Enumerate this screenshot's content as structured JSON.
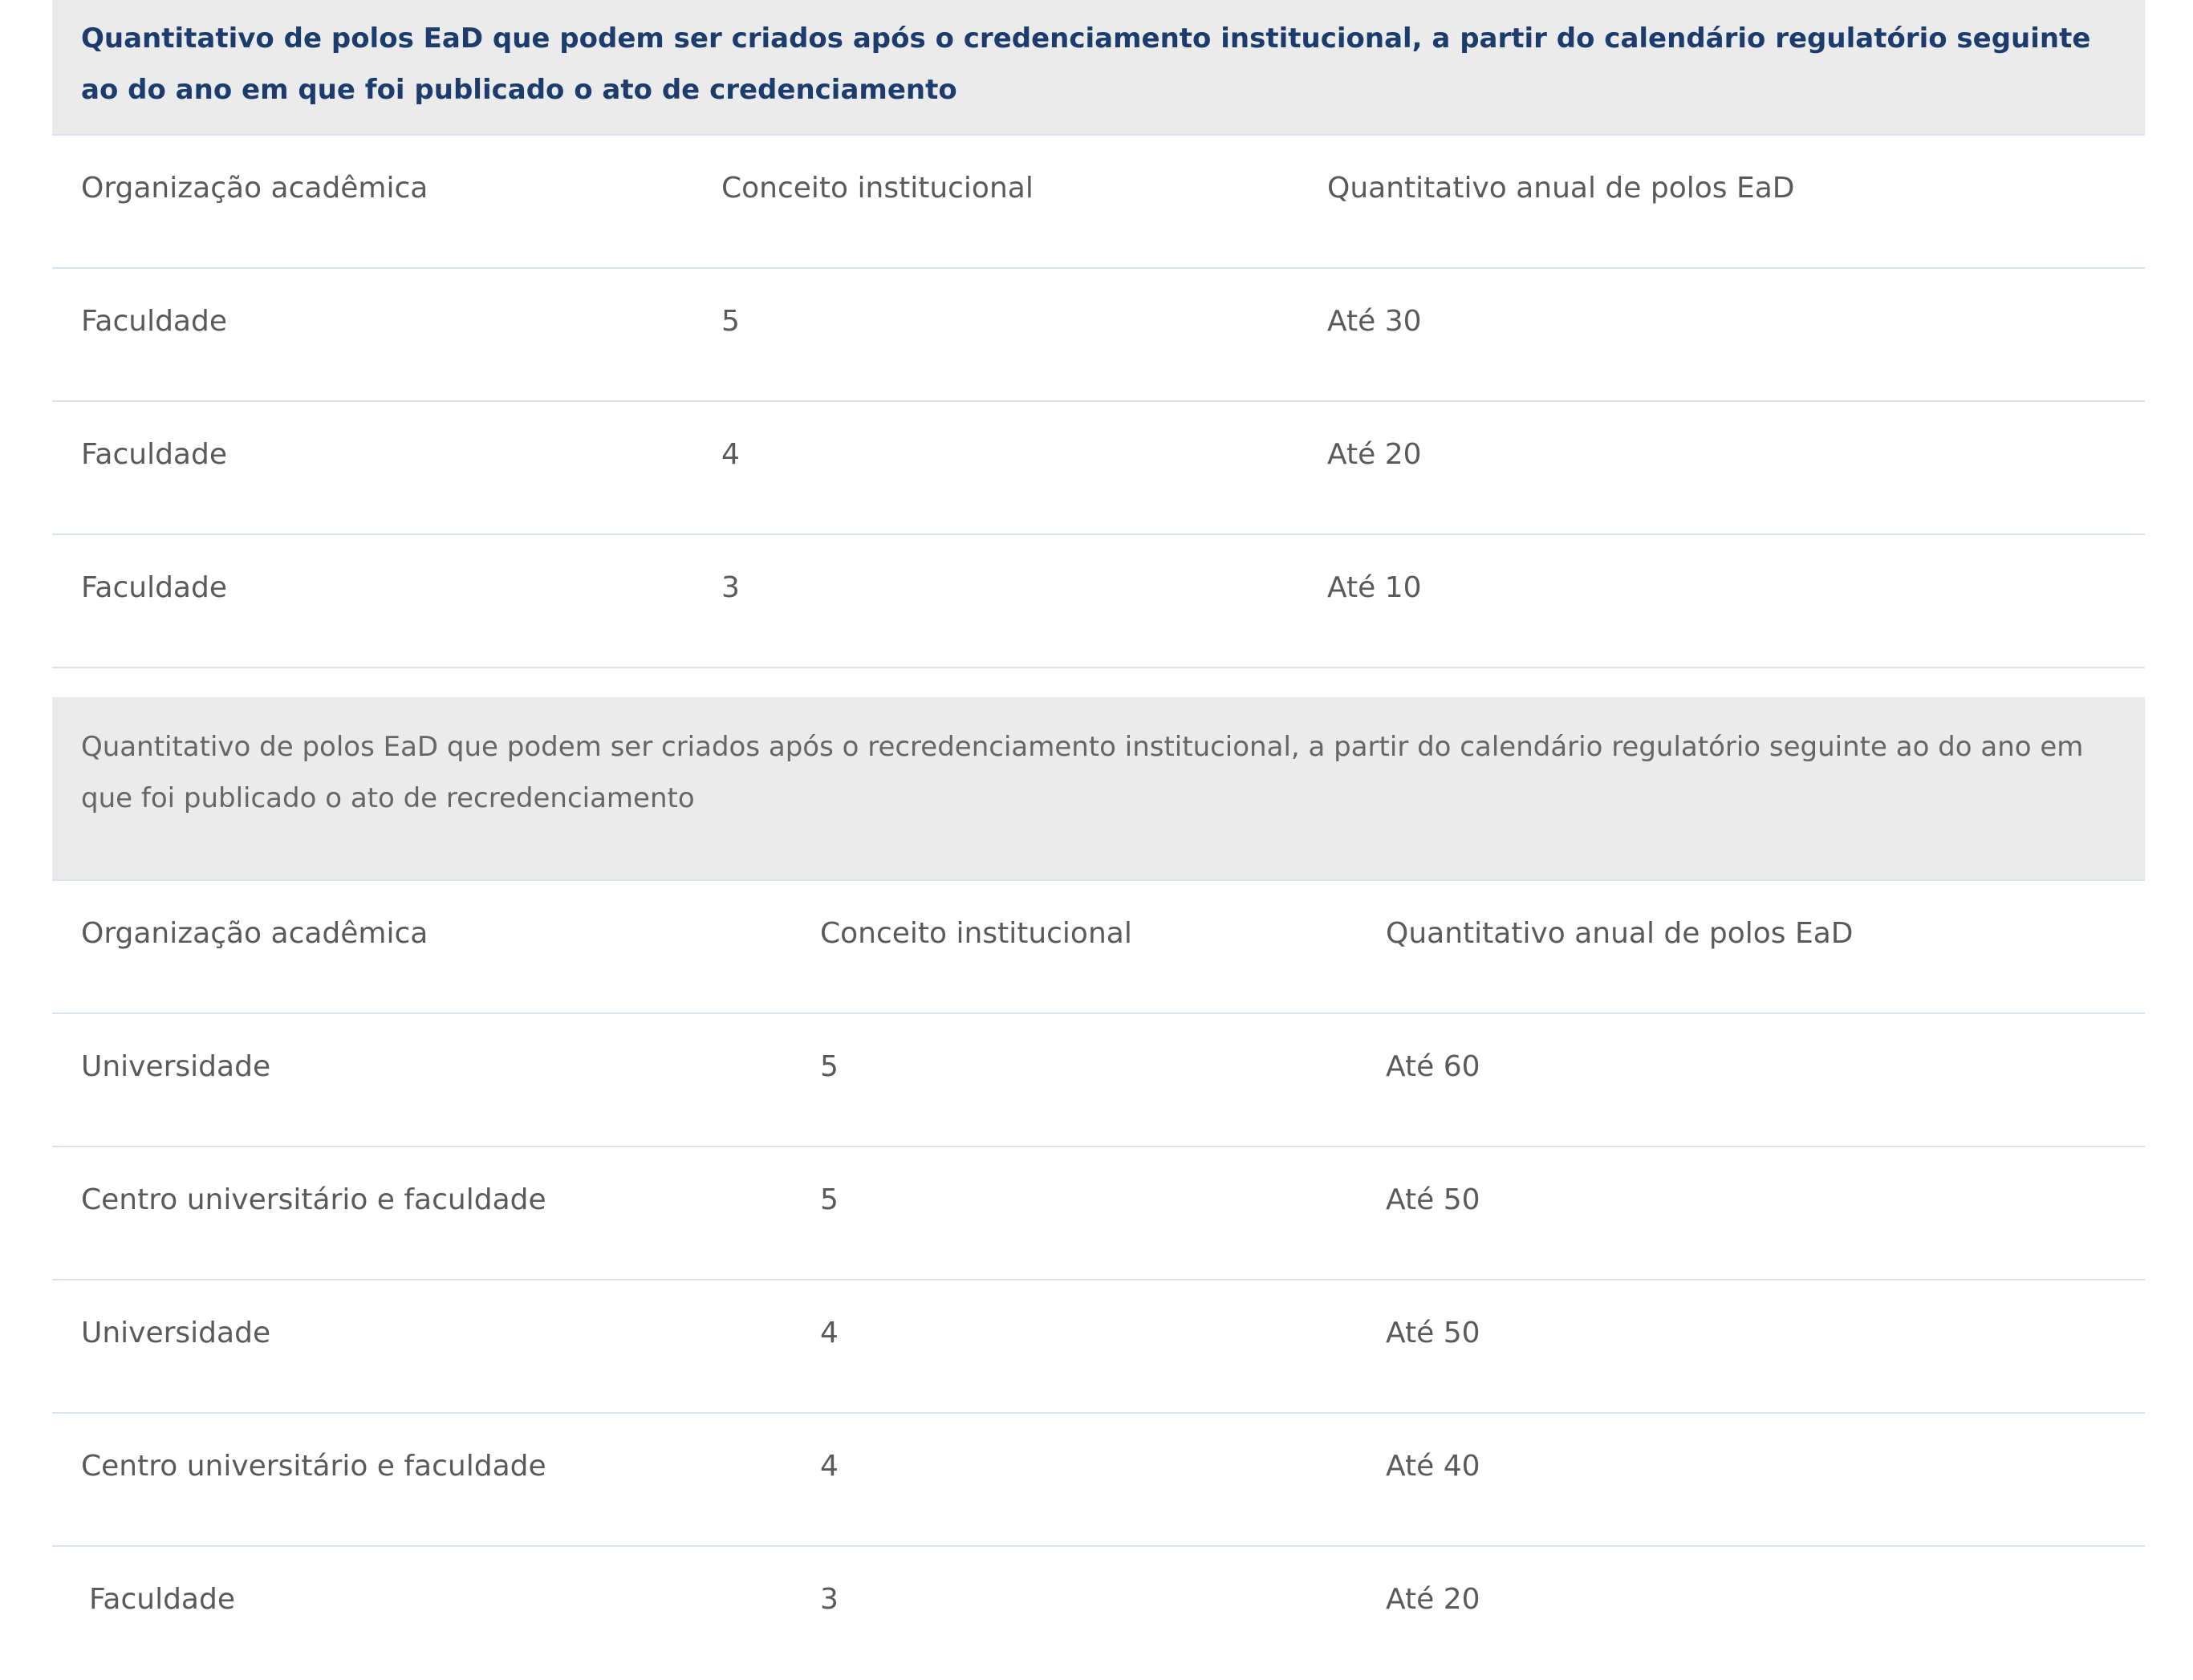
{
  "table1": {
    "caption": "Quantitativo de polos EaD que podem ser criados após o credenciamento institucional, a partir do calendário regulatório seguinte ao do ano em que foi publicado o ato de credenciamento",
    "headers": [
      "Organização acadêmica",
      "Conceito institucional",
      "Quantitativo anual de polos EaD"
    ],
    "rows": [
      [
        "Faculdade",
        "5",
        "Até 30"
      ],
      [
        "Faculdade",
        "4",
        "Até 20"
      ],
      [
        "Faculdade",
        "3",
        "Até 10"
      ]
    ]
  },
  "table2": {
    "caption": "Quantitativo de polos EaD que podem ser criados após o recredenciamento institucional, a partir do calendário regulatório seguinte ao do ano em que foi publicado o ato de recredenciamento",
    "headers": [
      "Organização acadêmica",
      "Conceito institucional",
      "Quantitativo anual de polos EaD"
    ],
    "rows": [
      [
        "Universidade",
        "5",
        "Até 60"
      ],
      [
        "Centro universitário e faculdade",
        "5",
        "Até 50"
      ],
      [
        "Universidade",
        "4",
        "Até 50"
      ],
      [
        "Centro universitário e faculdade",
        "4",
        "Até 40"
      ],
      [
        "Faculdade",
        "3",
        "Até 20"
      ]
    ]
  }
}
